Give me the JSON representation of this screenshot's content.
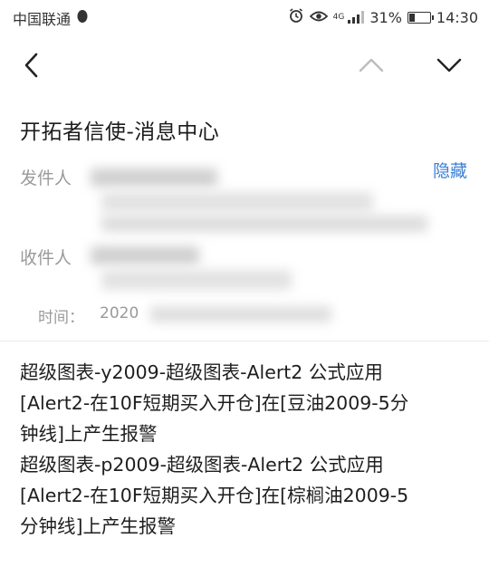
{
  "status_bar": {
    "carrier": "中国联通",
    "network": "4G",
    "battery": "31%",
    "battery_level": 0.31,
    "time": "14:30",
    "icons": [
      "penguin-icon",
      "alarm-icon",
      "eye-icon",
      "signal-icon",
      "battery-icon"
    ]
  },
  "toolbar": {
    "icons": [
      "back-arrow-icon",
      "chevron-up-icon",
      "chevron-down-icon"
    ]
  },
  "message": {
    "subject": "开拓者信使-消息中心",
    "hide_label": "隐藏",
    "from_label": "发件人",
    "to_label": "收件人",
    "time_label": "时间：",
    "time_value": "2020",
    "body_lines": [
      "超级图表-y2009-超级图表-Alert2 公式应用",
      "[Alert2-在10F短期买入开仓]在[豆油2009-5分",
      "钟线]上产生报警",
      "超级图表-p2009-超级图表-Alert2 公式应用",
      "[Alert2-在10F短期买入开仓]在[棕榈油2009-5",
      "分钟线]上产生报警"
    ]
  },
  "colors": {
    "accent": "#3b7fd6",
    "meta_text": "#9a9a9a",
    "body_text": "#1e1e1e"
  }
}
